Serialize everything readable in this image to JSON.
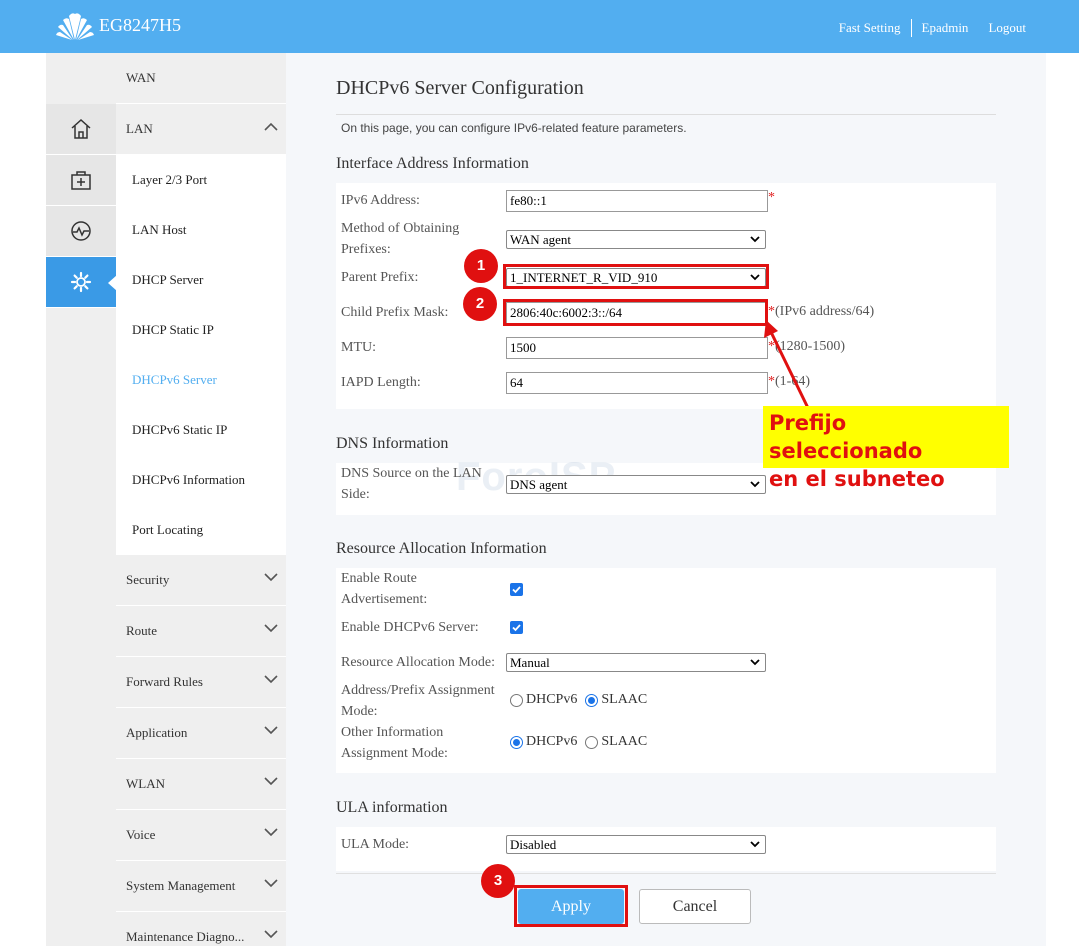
{
  "header": {
    "product": "EG8247H5",
    "links": [
      "Fast Setting",
      "Epadmin",
      "Logout"
    ]
  },
  "sidebar": {
    "icons": [
      "home-icon",
      "medkit-icon",
      "pulse-icon",
      "gear-icon"
    ],
    "items": [
      {
        "label": "WAN"
      },
      {
        "label": "LAN"
      },
      {
        "label": "Layer 2/3 Port"
      },
      {
        "label": "LAN Host"
      },
      {
        "label": "DHCP Server"
      },
      {
        "label": "DHCP Static IP"
      },
      {
        "label": "DHCPv6 Server"
      },
      {
        "label": "DHCPv6 Static IP"
      },
      {
        "label": "DHCPv6 Information"
      },
      {
        "label": "Port Locating"
      },
      {
        "label": "Security"
      },
      {
        "label": "Route"
      },
      {
        "label": "Forward Rules"
      },
      {
        "label": "Application"
      },
      {
        "label": "WLAN"
      },
      {
        "label": "Voice"
      },
      {
        "label": "System Management"
      },
      {
        "label": "Maintenance Diagno..."
      }
    ]
  },
  "page": {
    "title": "DHCPv6 Server Configuration",
    "description": "On this page, you can configure IPv6-related feature parameters."
  },
  "interface": {
    "title": "Interface Address Information",
    "ipv6_label": "IPv6 Address:",
    "ipv6_value": "fe80::1",
    "method_label": "Method of Obtaining Prefixes:",
    "method_value": "WAN agent",
    "parent_label": "Parent Prefix:",
    "parent_value": "1_INTERNET_R_VID_910",
    "child_label": "Child Prefix Mask:",
    "child_value": "2806:40c:6002:3::/64",
    "child_hint": "(IPv6 address/64)",
    "mtu_label": "MTU:",
    "mtu_value": "1500",
    "mtu_hint": "(1280-1500)",
    "iapd_label": "IAPD Length:",
    "iapd_value": "64",
    "iapd_hint": "(1-64)",
    "required_mark": "*"
  },
  "dns": {
    "title": "DNS Information",
    "source_label": "DNS Source on the LAN Side:",
    "source_value": "DNS agent"
  },
  "resource": {
    "title": "Resource Allocation Information",
    "route_adv_label": "Enable Route Advertisement:",
    "route_adv_checked": true,
    "dhcpv6_label": "Enable DHCPv6 Server:",
    "dhcpv6_checked": true,
    "mode_label": "Resource Allocation Mode:",
    "mode_value": "Manual",
    "addr_mode_label": "Address/Prefix Assignment Mode:",
    "other_mode_label": "Other Information Assignment Mode:",
    "opt_dhcpv6": "DHCPv6",
    "opt_slaac": "SLAAC",
    "addr_mode_selected": "SLAAC",
    "other_mode_selected": "DHCPv6"
  },
  "ula": {
    "title": "ULA information",
    "mode_label": "ULA Mode:",
    "mode_value": "Disabled"
  },
  "buttons": {
    "apply": "Apply",
    "cancel": "Cancel"
  },
  "annotations": {
    "badge1": "1",
    "badge2": "2",
    "badge3": "3",
    "callout_line1": "Prefijo seleccionado",
    "callout_line2": "en el subneteo",
    "watermark": "ForoISP",
    "color": "#e01010"
  },
  "colors": {
    "accent": "#52aef0",
    "active_icon": "#3a9ae6",
    "selected_menu": "#52aef0"
  }
}
